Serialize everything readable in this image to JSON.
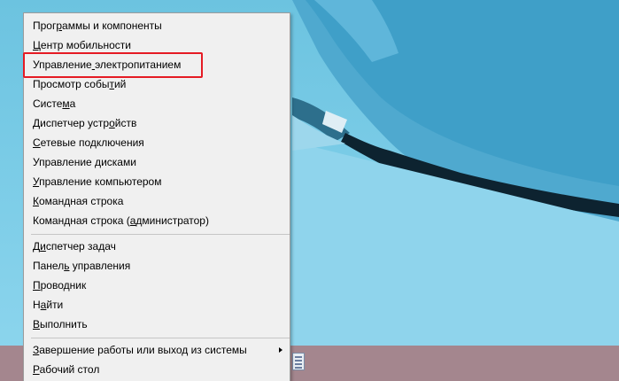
{
  "context_menu": {
    "items": [
      {
        "id": "programs-and-features",
        "text": "Программы и компоненты",
        "mnemonic_index": 4
      },
      {
        "id": "mobility-center",
        "text": "Центр мобильности",
        "mnemonic_index": 0
      },
      {
        "id": "power-options",
        "text": "Управление электропитанием",
        "mnemonic_index": 10
      },
      {
        "id": "event-viewer",
        "text": "Просмотр событий",
        "mnemonic_index": 13
      },
      {
        "id": "system",
        "text": "Система",
        "mnemonic_index": 5
      },
      {
        "id": "device-manager",
        "text": "Диспетчер устройств",
        "mnemonic_index": 14
      },
      {
        "id": "network-connections",
        "text": "Сетевые подключения",
        "mnemonic_index": 0
      },
      {
        "id": "disk-management",
        "text": "Управление дисками",
        "mnemonic_index": 11
      },
      {
        "id": "computer-management",
        "text": "Управление компьютером",
        "mnemonic_index": 0
      },
      {
        "id": "command-prompt",
        "text": "Командная строка",
        "mnemonic_index": 0
      },
      {
        "id": "command-prompt-admin",
        "text": "Командная строка (администратор)",
        "mnemonic_index": 18
      },
      {
        "id": "task-manager",
        "text": "Диспетчер задач",
        "mnemonic_index": 1
      },
      {
        "id": "control-panel",
        "text": "Панель управления",
        "mnemonic_index": 5
      },
      {
        "id": "file-explorer",
        "text": "Проводник",
        "mnemonic_index": 0
      },
      {
        "id": "search",
        "text": "Найти",
        "mnemonic_index": 1
      },
      {
        "id": "run",
        "text": "Выполнить",
        "mnemonic_index": 0
      },
      {
        "id": "shutdown-or-sign-out",
        "text": "Завершение работы или выход из системы",
        "mnemonic_index": 0,
        "has_submenu": true
      },
      {
        "id": "desktop",
        "text": "Рабочий стол",
        "mnemonic_index": 0
      }
    ]
  },
  "highlighted_item": "power-options",
  "colors": {
    "highlight_border": "#e51b24",
    "menu_background": "#f0f0f0",
    "taskbar": "#a4868e"
  }
}
